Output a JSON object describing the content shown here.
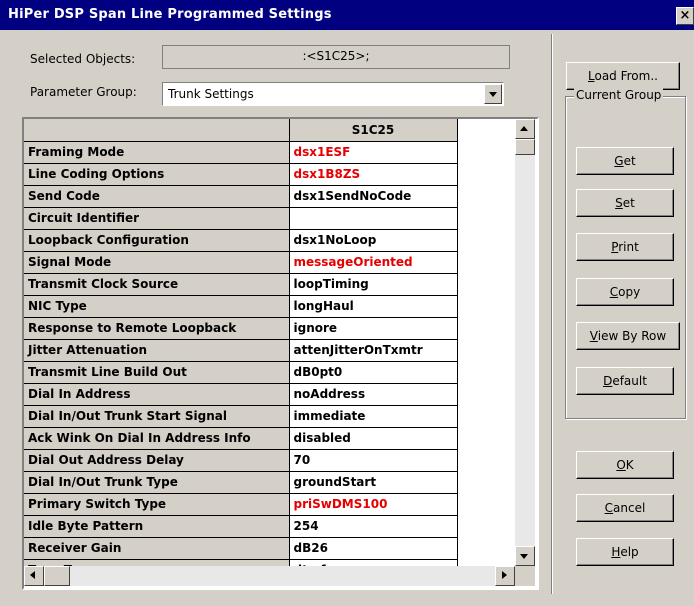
{
  "window": {
    "title": "HiPer DSP Span Line Programmed Settings",
    "close_label": "×"
  },
  "selected_objects": {
    "label": "Selected Objects:",
    "value": ":<S1C25>;"
  },
  "parameter_group": {
    "label": "Parameter Group:",
    "value": "Trunk Settings"
  },
  "grid": {
    "column_header": "S1C25",
    "highlight_color": "#e60000",
    "rows": [
      {
        "name": "Framing Mode",
        "value": "dsx1ESF",
        "highlight": true
      },
      {
        "name": "Line Coding Options",
        "value": "dsx1B8ZS",
        "highlight": true
      },
      {
        "name": "Send Code",
        "value": "dsx1SendNoCode",
        "highlight": false
      },
      {
        "name": "Circuit Identifier",
        "value": "",
        "highlight": false
      },
      {
        "name": "Loopback Configuration",
        "value": "dsx1NoLoop",
        "highlight": false
      },
      {
        "name": "Signal Mode",
        "value": "messageOriented",
        "highlight": true
      },
      {
        "name": "Transmit Clock Source",
        "value": "loopTiming",
        "highlight": false
      },
      {
        "name": "NIC Type",
        "value": "longHaul",
        "highlight": false
      },
      {
        "name": "Response to Remote Loopback",
        "value": "ignore",
        "highlight": false
      },
      {
        "name": "Jitter Attenuation",
        "value": "attenJitterOnTxmtr",
        "highlight": false
      },
      {
        "name": "Transmit Line Build Out",
        "value": "dB0pt0",
        "highlight": false
      },
      {
        "name": "Dial In Address",
        "value": "noAddress",
        "highlight": false
      },
      {
        "name": "Dial In/Out Trunk Start Signal",
        "value": "immediate",
        "highlight": false
      },
      {
        "name": "Ack Wink On Dial In Address Info",
        "value": "disabled",
        "highlight": false
      },
      {
        "name": "Dial Out Address Delay",
        "value": "70",
        "highlight": false
      },
      {
        "name": "Dial In/Out Trunk Type",
        "value": "groundStart",
        "highlight": false
      },
      {
        "name": "Primary Switch Type",
        "value": "priSwDMS100",
        "highlight": true
      },
      {
        "name": "Idle Byte Pattern",
        "value": "254",
        "highlight": false
      },
      {
        "name": "Receiver Gain",
        "value": "dB26",
        "highlight": false
      },
      {
        "name": "Tone Type",
        "value": "dtmf",
        "highlight": false
      }
    ]
  },
  "buttons": {
    "load_from": {
      "mnemonic": "L",
      "rest": "oad From.."
    },
    "current_group_label": "Current Group",
    "get": {
      "mnemonic": "G",
      "rest": "et"
    },
    "set": {
      "mnemonic": "S",
      "rest": "et"
    },
    "print": {
      "mnemonic": "P",
      "rest": "rint"
    },
    "copy": {
      "mnemonic": "C",
      "rest": "opy"
    },
    "view_by_row": {
      "mnemonic": "V",
      "rest": "iew By Row"
    },
    "default": {
      "mnemonic": "D",
      "rest": "efault"
    },
    "ok": {
      "mnemonic": "O",
      "rest": "K"
    },
    "cancel": {
      "mnemonic": "C",
      "rest": "ancel"
    },
    "help": {
      "mnemonic": "H",
      "rest": "elp"
    }
  }
}
